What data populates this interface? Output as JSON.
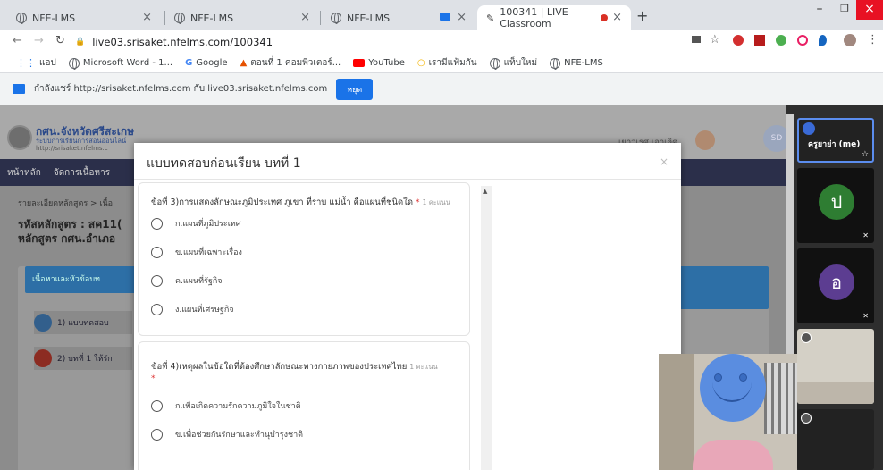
{
  "browser": {
    "tabs": [
      {
        "title": "NFE-LMS"
      },
      {
        "title": "NFE-LMS"
      },
      {
        "title": "NFE-LMS"
      },
      {
        "title": "100341 | LIVE Classroom"
      }
    ],
    "new_tab": "+",
    "url": "live03.srisaket.nfelms.com/100341",
    "bookmarks": [
      "แอป",
      "Microsoft Word - 1...",
      "Google",
      "ตอนที่ 1 คอมพิวเตอร์...",
      "YouTube",
      "เรามีแฟ้มกัน",
      "แท็บใหม่",
      "NFE-LMS"
    ],
    "share_msg": "กำลังแชร์ http://srisaket.nfelms.com กับ live03.srisaket.nfelms.com",
    "share_btn": "หยุด"
  },
  "site": {
    "logo_title": "กศน.จังหวัดศรีสะเกษ",
    "logo_sub": "ระบบการเรียนการสอนออนไลน์",
    "logo_url": "http://srisaket.nfelms.c",
    "user_name": "เยาวเรศ เอาเลิศ",
    "nav": [
      "หน้าหลัก",
      "จัดการเนื้อหาร"
    ],
    "breadcrumb": "รายละเอียดหลักสูตร > เนื้อ",
    "course_code": "รหัสหลักสูตร : สค11(",
    "course_name": "หลักสูตร กศน.อำเภอ",
    "side_header": "เนื้อหาและหัวข้อบท",
    "side_item1": "1) แบบทดสอบ",
    "side_item2": "2) บทที่ 1 ให้รัก"
  },
  "modal": {
    "title": "แบบทดสอบก่อนเรียน บทที่ 1",
    "close": "×",
    "q3": {
      "text": "ข้อที่ 3)การแสดงลักษณะภูมิประเทศ ภูเขา ที่ราบ แม่น้ำ คือแผนที่ชนิดใด",
      "req": "*",
      "pts": "1 คะแนน",
      "options": [
        "ก.แผนที่ภูมิประเทศ",
        "ข.แผนที่เฉพาะเรื่อง",
        "ค.แผนที่รัฐกิจ",
        "ง.แผนที่เศรษฐกิจ"
      ]
    },
    "q4": {
      "text": "ข้อที่ 4)เหตุผลในข้อใดที่ต้องศึกษาลักษณะทางกายภาพของประเทศไทย",
      "req": "*",
      "pts": "1 คะแนน",
      "options": [
        "ก.เพื่อเกิดความรักความภูมิใจในชาติ",
        "ข.เพื่อช่วยกันรักษาและทำนุบำรุงชาติ"
      ]
    }
  },
  "video": {
    "host_name": "ครูยาย่า (me)",
    "p1": "ป",
    "p2": "อ",
    "sd": "SD"
  },
  "colors": {
    "p1": "#2e7d32",
    "p2": "#5c3d91",
    "share_btn": "#1a73e8",
    "nav": "#2b2f4a"
  }
}
